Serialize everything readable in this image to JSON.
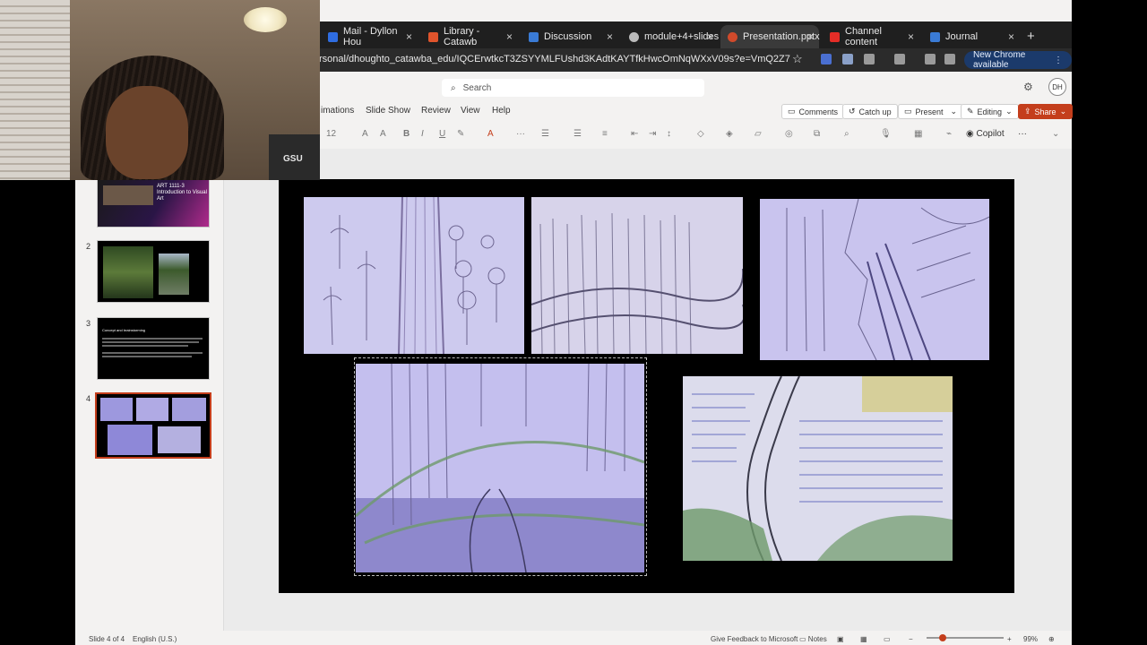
{
  "browser": {
    "tabs": [
      {
        "label": "Mail - Dyllon Hou",
        "color": "#2f6de1"
      },
      {
        "label": "Library - Catawb",
        "color": "#e0542c"
      },
      {
        "label": "Discussion",
        "color": "#3a7bd5"
      },
      {
        "label": "module+4+slides",
        "color": "#bbbbbb"
      },
      {
        "label": "Presentation.pptx",
        "color": "#d04a2b"
      },
      {
        "label": "Channel content",
        "color": "#e52d27"
      },
      {
        "label": "Journal",
        "color": "#3a7bd5"
      }
    ],
    "url": "rsonal/dhoughto_catawba_edu/IQCErwtkcT3ZSYYMLFUshd3KAdtKAYTfkHwcOmNqWXxV09s?e=VmQ2Z7",
    "new_chrome_label": "New Chrome available"
  },
  "app": {
    "search_placeholder": "Search",
    "avatar_initials": "DH",
    "ribbon_tabs": [
      "imations",
      "Slide Show",
      "Review",
      "View",
      "Help"
    ],
    "buttons": {
      "comments": "Comments",
      "catchup": "Catch up",
      "present": "Present",
      "editing": "Editing",
      "share": "Share"
    },
    "font_size": "12",
    "copilot": "Copilot"
  },
  "thumbnails": {
    "slide1_title": "ART 1111-3 Introduction to Visual Art",
    "numbers": [
      "2",
      "3",
      "4"
    ],
    "slide3_title": "Concept and brainstorming"
  },
  "status": {
    "slide_position": "Slide 4 of 4",
    "language": "English (U.S.)",
    "feedback": "Give Feedback to Microsoft",
    "notes": "Notes",
    "zoom": "99%"
  }
}
